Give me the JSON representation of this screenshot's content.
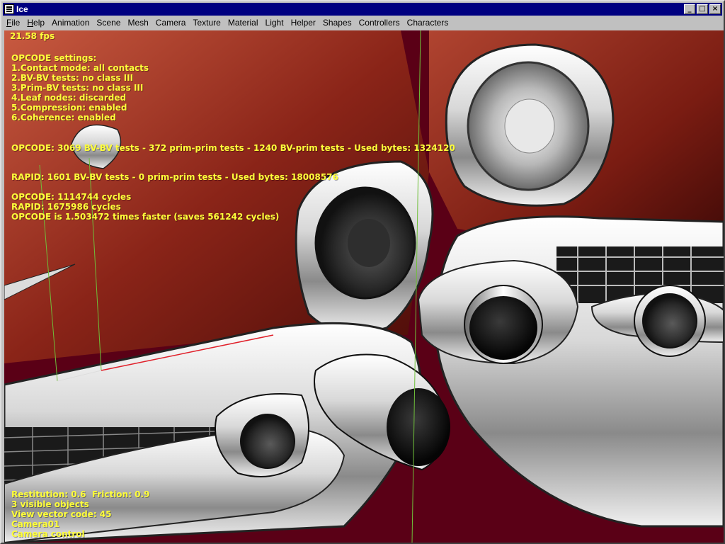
{
  "window": {
    "title": "Ice",
    "buttons": [
      "_",
      "□",
      "×"
    ]
  },
  "menubar": [
    {
      "label": "File"
    },
    {
      "label": "Help"
    },
    {
      "label": "Animation"
    },
    {
      "label": "Scene"
    },
    {
      "label": "Mesh"
    },
    {
      "label": "Camera"
    },
    {
      "label": "Texture"
    },
    {
      "label": "Material"
    },
    {
      "label": "Light"
    },
    {
      "label": "Helper"
    },
    {
      "label": "Shapes"
    },
    {
      "label": "Controllers"
    },
    {
      "label": "Characters"
    }
  ],
  "hud": {
    "fps": "21.58 fps",
    "opcode_settings": [
      "OPCODE settings:",
      "1.Contact mode: all contacts",
      "2.BV-BV tests: no class III",
      "3.Prim-BV tests: no class III",
      "4.Leaf nodes: discarded",
      "5.Compression: enabled",
      "6.Coherence: enabled"
    ],
    "opcode_stats": "OPCODE: 3069 BV-BV tests - 372 prim-prim tests - 1240 BV-prim tests - Used bytes: 1324120",
    "rapid_stats": "RAPID: 1601 BV-BV tests - 0 prim-prim tests - Used bytes: 18008576",
    "cycles": [
      "OPCODE: 1114744 cycles",
      "RAPID: 1675986 cycles",
      "OPCODE is 1.503472 times faster (saves 561242 cycles)"
    ],
    "bottom": [
      "Restitution: 0.6  Friction: 0.9",
      "3 visible objects",
      "View vector code: 45",
      "Camera01",
      "Camera control"
    ]
  },
  "colors": {
    "hud_text": "#ffff3a",
    "background": "#5a0016",
    "car_body": "#9a2a1c",
    "title_bar": "#000080"
  }
}
